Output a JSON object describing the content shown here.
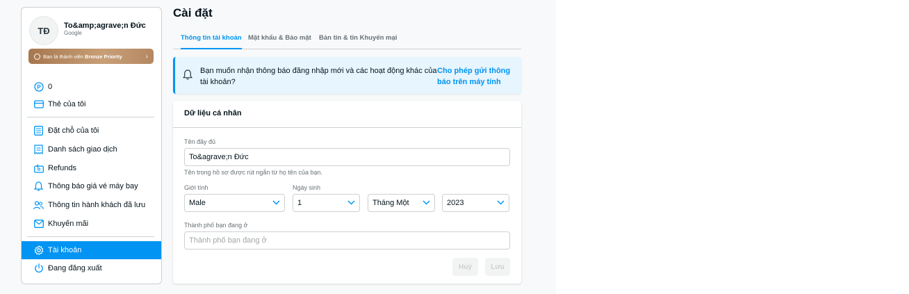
{
  "colors": {
    "accent": "#0194f3",
    "bronze": "#b48762"
  },
  "user": {
    "initials": "TĐ",
    "name": "To&amp;agrave;n Đức",
    "provider": "Google"
  },
  "membership": {
    "label": "Bạn là thành viên ",
    "tier": "Bronze Priority"
  },
  "sidebar": {
    "items": [
      {
        "label": "0",
        "icon": "points-icon"
      },
      {
        "label": "Thẻ của tôi",
        "icon": "card-icon"
      },
      {
        "label": "Đặt chỗ của tôi",
        "icon": "booking-list-icon"
      },
      {
        "label": "Danh sách giao dịch",
        "icon": "receipt-icon"
      },
      {
        "label": "Refunds",
        "icon": "refund-icon"
      },
      {
        "label": "Thông báo giá vé máy bay",
        "icon": "bell-icon"
      },
      {
        "label": "Thông tin hành khách đã lưu",
        "icon": "passengers-icon"
      },
      {
        "label": "Khuyến mãi",
        "icon": "promo-mail-icon"
      },
      {
        "label": "Tài khoản",
        "icon": "gear-icon",
        "active": true
      },
      {
        "label": "Đang đăng xuất",
        "icon": "power-icon"
      }
    ]
  },
  "page": {
    "title": "Cài đặt"
  },
  "tabs": [
    {
      "label": "Thông tin tài khoản",
      "active": true
    },
    {
      "label": "Mật khẩu & Bảo mật"
    },
    {
      "label": "Bản tin & tin Khuyến mại"
    }
  ],
  "notice": {
    "message": "Bạn muốn nhận thông báo đăng nhập mới và các hoạt động khác của tài khoản?",
    "action": "Cho phép gửi thông báo trên máy tính"
  },
  "form": {
    "title": "Dữ liệu cá nhân",
    "full_name_label": "Tên đầy đủ",
    "full_name_value": "To&agrave;n Đức",
    "full_name_hint": "Tên trong hồ sơ được rút ngắn từ họ tên của bạn.",
    "gender_label": "Giới tính",
    "gender_value": "Male",
    "dob_label": "Ngày sinh",
    "dob_day": "1",
    "dob_month": "Tháng Một",
    "dob_year": "2023",
    "city_label": "Thành phố bạn đang ở",
    "city_placeholder": "Thành phố bạn đang ở",
    "cancel_label": "Huỷ",
    "save_label": "Lưu"
  }
}
